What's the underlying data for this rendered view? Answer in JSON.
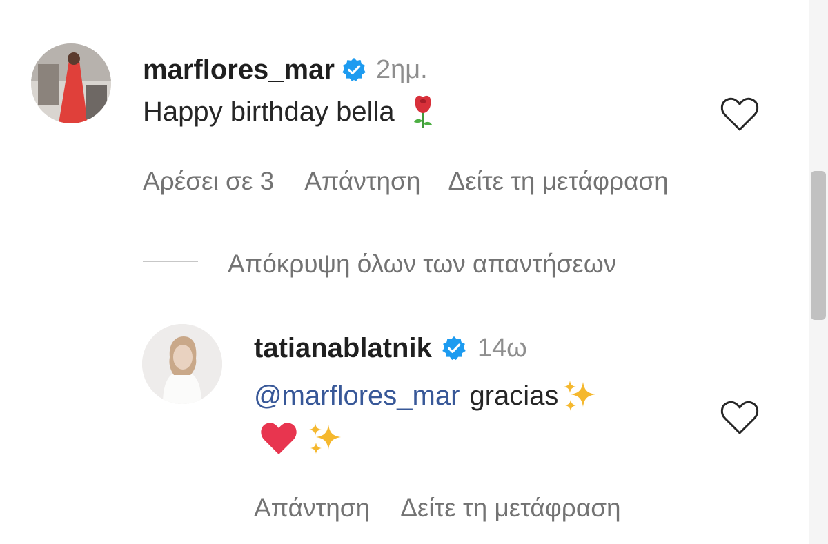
{
  "comment": {
    "username": "marflores_mar",
    "verified_icon": "verified-badge-icon",
    "time": "2ημ.",
    "text": "Happy birthday bella",
    "emoji": "rose",
    "likes_label": "Αρέσει σε 3",
    "reply_label": "Απάντηση",
    "translate_label": "Δείτε τη μετάφραση",
    "like_icon": "heart-outline-icon"
  },
  "replies_toggle": {
    "label": "Απόκρυψη όλων των απαντήσεων"
  },
  "reply": {
    "username": "tatianablatnik",
    "verified_icon": "verified-badge-icon",
    "time": "14ω",
    "mention": "@marflores_mar",
    "text": "gracias",
    "emojis": [
      "sparkles",
      "red-heart",
      "sparkles"
    ],
    "reply_label": "Απάντηση",
    "translate_label": "Δείτε τη μετάφραση",
    "like_icon": "heart-outline-icon"
  },
  "colors": {
    "verified": "#1D9BF0",
    "mention": "#385898",
    "secondary_text": "#737373"
  }
}
